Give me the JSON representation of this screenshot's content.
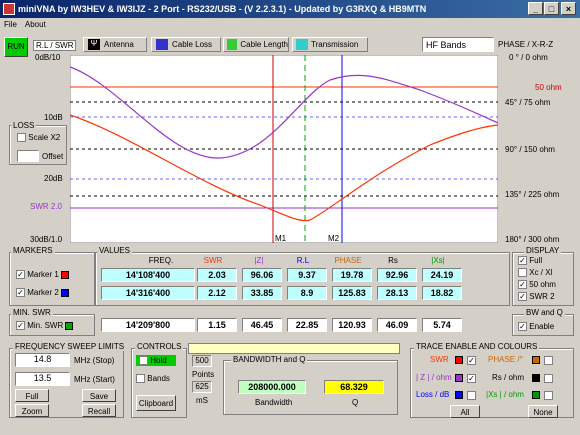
{
  "window": {
    "title": "miniVNA by IW3HEV & IW3IJZ - 2 Port - RS232/USB -  (V 2.2.3.1) - Updated by G3RXQ & HB9MTN"
  },
  "menu": [
    "File",
    "About"
  ],
  "toolbar": {
    "run": "RUN",
    "rl_swr": "R.L / SWR",
    "antenna": "Antenna",
    "cable_loss": "Cable Loss",
    "cable_length": "Cable Length",
    "transmission": "Transmission",
    "bands": "HF Bands",
    "phase": "PHASE / X-R-Z"
  },
  "chart_left": {
    "top": "0dB/10",
    "l10": "10dB",
    "l20": "20dB",
    "swr2": "SWR 2.0",
    "bottom": "30dB/1.0"
  },
  "chart_right": {
    "r0": "0 ° / 0 ohm",
    "r50": "50 ohm",
    "r45": "45° / 75 ohm",
    "r90": "90° / 150 ohm",
    "r135": "135° / 225 ohm",
    "r180": "180° / 300 ohm"
  },
  "markers_on_chart": {
    "m1": "M1",
    "m2": "M2"
  },
  "loss": {
    "title": "LOSS",
    "scale": "Scale X2",
    "offset": "Offset"
  },
  "markers": {
    "title": "MARKERS",
    "m1": "Marker 1",
    "m2": "Marker 2"
  },
  "values": {
    "title": "VALUES",
    "headers": [
      "FREQ.",
      "SWR",
      "|Z|",
      "R.L",
      "PHASE",
      "Rs",
      "|Xs|"
    ],
    "rows": [
      [
        "14'108'400",
        "2.03",
        "96.06",
        "9.37",
        "19.78",
        "92.96",
        "24.19"
      ],
      [
        "14'316'400",
        "2.12",
        "33.85",
        "8.9",
        "125.83",
        "28.13",
        "18.82"
      ]
    ],
    "min_row": [
      "14'209'800",
      "1.15",
      "46.45",
      "22.85",
      "120.93",
      "46.09",
      "5.74"
    ]
  },
  "display": {
    "title": "DISPLAY",
    "items": [
      "Full",
      "Xc / Xl",
      "50 ohm",
      "SWR 2"
    ]
  },
  "minswr": {
    "title": "MIN. SWR",
    "label": "Min. SWR"
  },
  "bwq": {
    "title": "BW and Q",
    "enable": "Enable"
  },
  "sweep": {
    "title": "FREQUENCY SWEEP LIMITS",
    "stop_val": "14.8",
    "stop_lbl": "MHz (Stop)",
    "start_val": "13.5",
    "start_lbl": "MHz (Start)",
    "full": "Full",
    "save": "Save",
    "zoom": "Zoom",
    "recall": "Recall"
  },
  "controls": {
    "title": "CONTROLS",
    "hold": "Hold",
    "bands": "Bands",
    "clipboard": "Clipboard",
    "points_val": "500",
    "points_lbl": "Points",
    "ms_val": "625",
    "ms_lbl": "mS"
  },
  "bandwidth": {
    "title": "BANDWIDTH and Q",
    "bw_val": "208000.000",
    "bw_lbl": "Bandwidth",
    "q_val": "68.329",
    "q_lbl": "Q"
  },
  "trace": {
    "title": "TRACE ENABLE AND COLOURS",
    "swr": "SWR",
    "phase": "PHASE /°",
    "z": "| Z | / ohm",
    "rs": "Rs / ohm",
    "loss": "Loss / dB",
    "xs": "|Xs | / ohm",
    "all": "All",
    "none": "None"
  },
  "colors": {
    "swr": "#ff3300",
    "z": "#9933cc",
    "phase": "#cc6600",
    "rs": "#000000",
    "loss": "#0000ff",
    "xs": "#009900"
  }
}
